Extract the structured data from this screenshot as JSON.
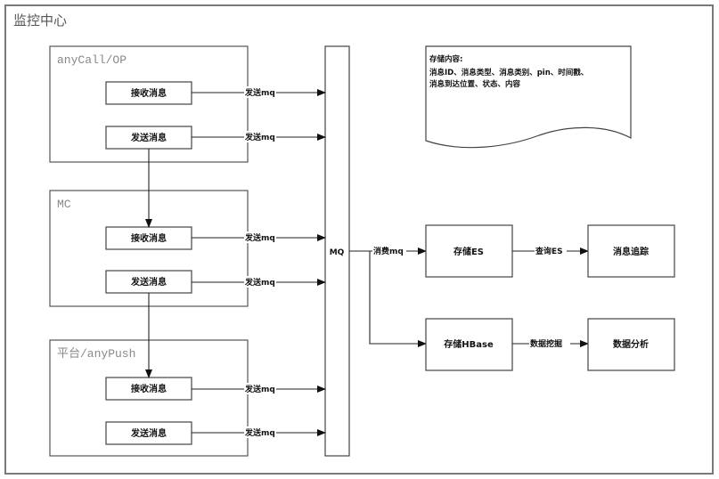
{
  "title": "监控中心",
  "groups": [
    {
      "label": "anyCall/OP",
      "receive": "接收消息",
      "send": "发送消息"
    },
    {
      "label": "MC",
      "receive": "接收消息",
      "send": "发送消息"
    },
    {
      "label": "平台/anyPush",
      "receive": "接收消息",
      "send": "发送消息"
    }
  ],
  "send_mq_label": "发送mq",
  "mq_label": "MQ",
  "consume_label": "消费mq",
  "note": {
    "heading": "存储内容:",
    "line1": "消息ID、消息类型、消息类别、pin、时间戳、",
    "line2": "消息到达位置、状态、内容"
  },
  "store_es": "存储ES",
  "query_es": "查询ES",
  "msg_trace": "消息追踪",
  "store_hbase": "存储HBase",
  "data_mining": "数据挖掘",
  "data_analysis": "数据分析"
}
